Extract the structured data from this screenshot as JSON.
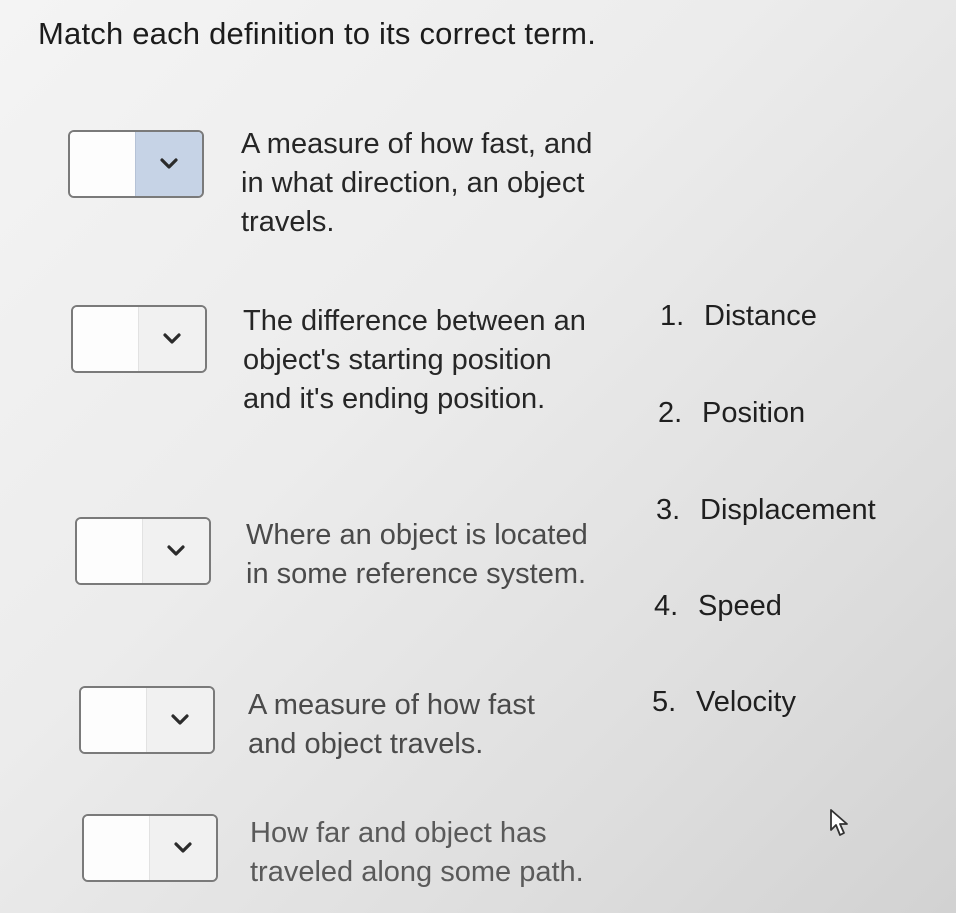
{
  "instruction": "Match each definition to its correct term.",
  "questions": [
    {
      "definition": "A measure of how fast, and in what direction, an object travels.",
      "selected": ""
    },
    {
      "definition": "The difference between an object's starting position and it's ending position.",
      "selected": ""
    },
    {
      "definition": "Where an object is located in some reference system.",
      "selected": ""
    },
    {
      "definition": "A measure of how fast and object travels.",
      "selected": ""
    },
    {
      "definition": "How far and object has traveled along some path.",
      "selected": ""
    }
  ],
  "terms": [
    {
      "number": "1.",
      "label": "Distance"
    },
    {
      "number": "2.",
      "label": "Position"
    },
    {
      "number": "3.",
      "label": "Displacement"
    },
    {
      "number": "4.",
      "label": "Speed"
    },
    {
      "number": "5.",
      "label": "Velocity"
    }
  ],
  "icons": {
    "dropdown": "chevron-down-icon",
    "cursor": "mouse-pointer-icon"
  },
  "colors": {
    "accent_arrow_bg": "#c6d3e6",
    "border": "#7a7a7a"
  }
}
